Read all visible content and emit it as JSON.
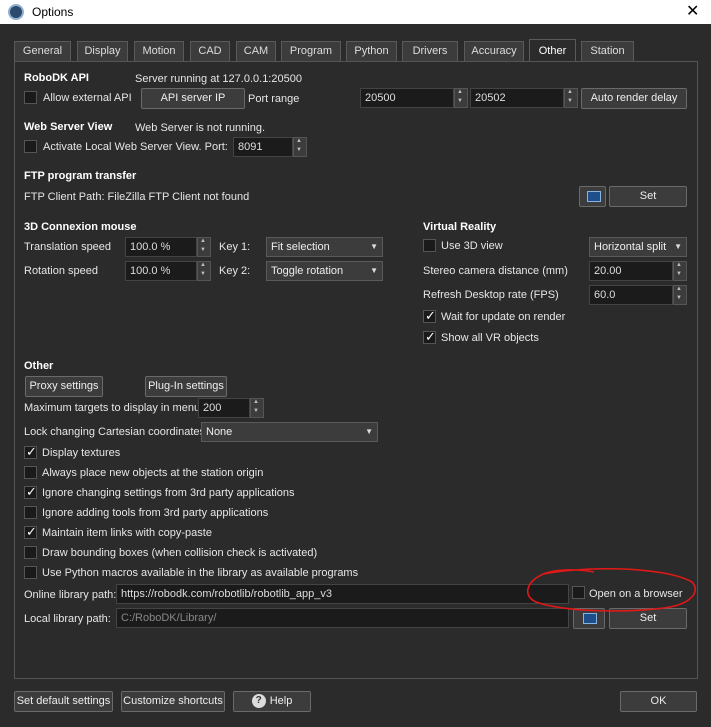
{
  "window": {
    "title": "Options"
  },
  "tabs": [
    "General",
    "Display",
    "Motion",
    "CAD",
    "CAM",
    "Program",
    "Python",
    "Drivers",
    "Accuracy",
    "Other",
    "Station"
  ],
  "robodk_api": {
    "heading": "RoboDK API",
    "status": "Server running at 127.0.0.1:20500",
    "allow_external_label": "Allow external API",
    "api_server_ip_button": "API server IP",
    "port_range_label": "Port range",
    "port_from": "20500",
    "port_to": "20502",
    "auto_render_delay_button": "Auto render delay"
  },
  "web_server": {
    "heading": "Web Server View",
    "status": "Web Server is not running.",
    "activate_label": "Activate Local Web Server View. Port:",
    "port": "8091"
  },
  "ftp": {
    "heading": "FTP program transfer",
    "client_path": "FTP Client Path: FileZilla FTP Client not found",
    "set_button": "Set"
  },
  "connexion": {
    "heading": "3D Connexion mouse",
    "translation_label": "Translation speed",
    "translation_value": "100.0 %",
    "rotation_label": "Rotation speed",
    "rotation_value": "100.0 %",
    "key1_label": "Key 1:",
    "key1_value": "Fit selection",
    "key2_label": "Key 2:",
    "key2_value": "Toggle rotation"
  },
  "vr": {
    "heading": "Virtual Reality",
    "use_3d_label": "Use 3D view",
    "split_value": "Horizontal split",
    "stereo_label": "Stereo camera distance (mm)",
    "stereo_value": "20.00",
    "refresh_label": "Refresh Desktop rate (FPS)",
    "refresh_value": "60.0",
    "wait_update_label": "Wait for update on render",
    "show_all_label": "Show all VR objects"
  },
  "other": {
    "heading": "Other",
    "proxy_button": "Proxy settings",
    "plugin_button": "Plug-In settings",
    "max_targets_label": "Maximum targets to display in menu",
    "max_targets_value": "200",
    "lock_cartesian_label": "Lock changing Cartesian coordinates",
    "lock_cartesian_value": "None",
    "checks": [
      {
        "label": "Display textures",
        "checked": true
      },
      {
        "label": "Always place new objects at the station origin",
        "checked": false
      },
      {
        "label": "Ignore changing settings from 3rd party applications",
        "checked": true
      },
      {
        "label": "Ignore adding tools from 3rd party applications",
        "checked": false
      },
      {
        "label": "Maintain item links with copy-paste",
        "checked": true
      },
      {
        "label": "Draw bounding boxes (when collision check is activated)",
        "checked": false
      },
      {
        "label": "Use Python macros available in the library as available programs",
        "checked": false
      }
    ],
    "online_library_label": "Online library path:",
    "online_library_value": "https://robodk.com/robotlib/robotlib_app_v3",
    "open_browser_label": "Open on a browser",
    "local_library_label": "Local library path:",
    "local_library_value": "C:/RoboDK/Library/",
    "local_set_button": "Set"
  },
  "footer": {
    "default_button": "Set default settings",
    "shortcuts_button": "Customize shortcuts",
    "help_button": "Help",
    "ok_button": "OK"
  },
  "colors": {
    "background": "#2b2b2b",
    "annotation": "#e01818"
  },
  "icons": [
    "app-icon",
    "close-icon",
    "browser-icon",
    "help-icon"
  ]
}
